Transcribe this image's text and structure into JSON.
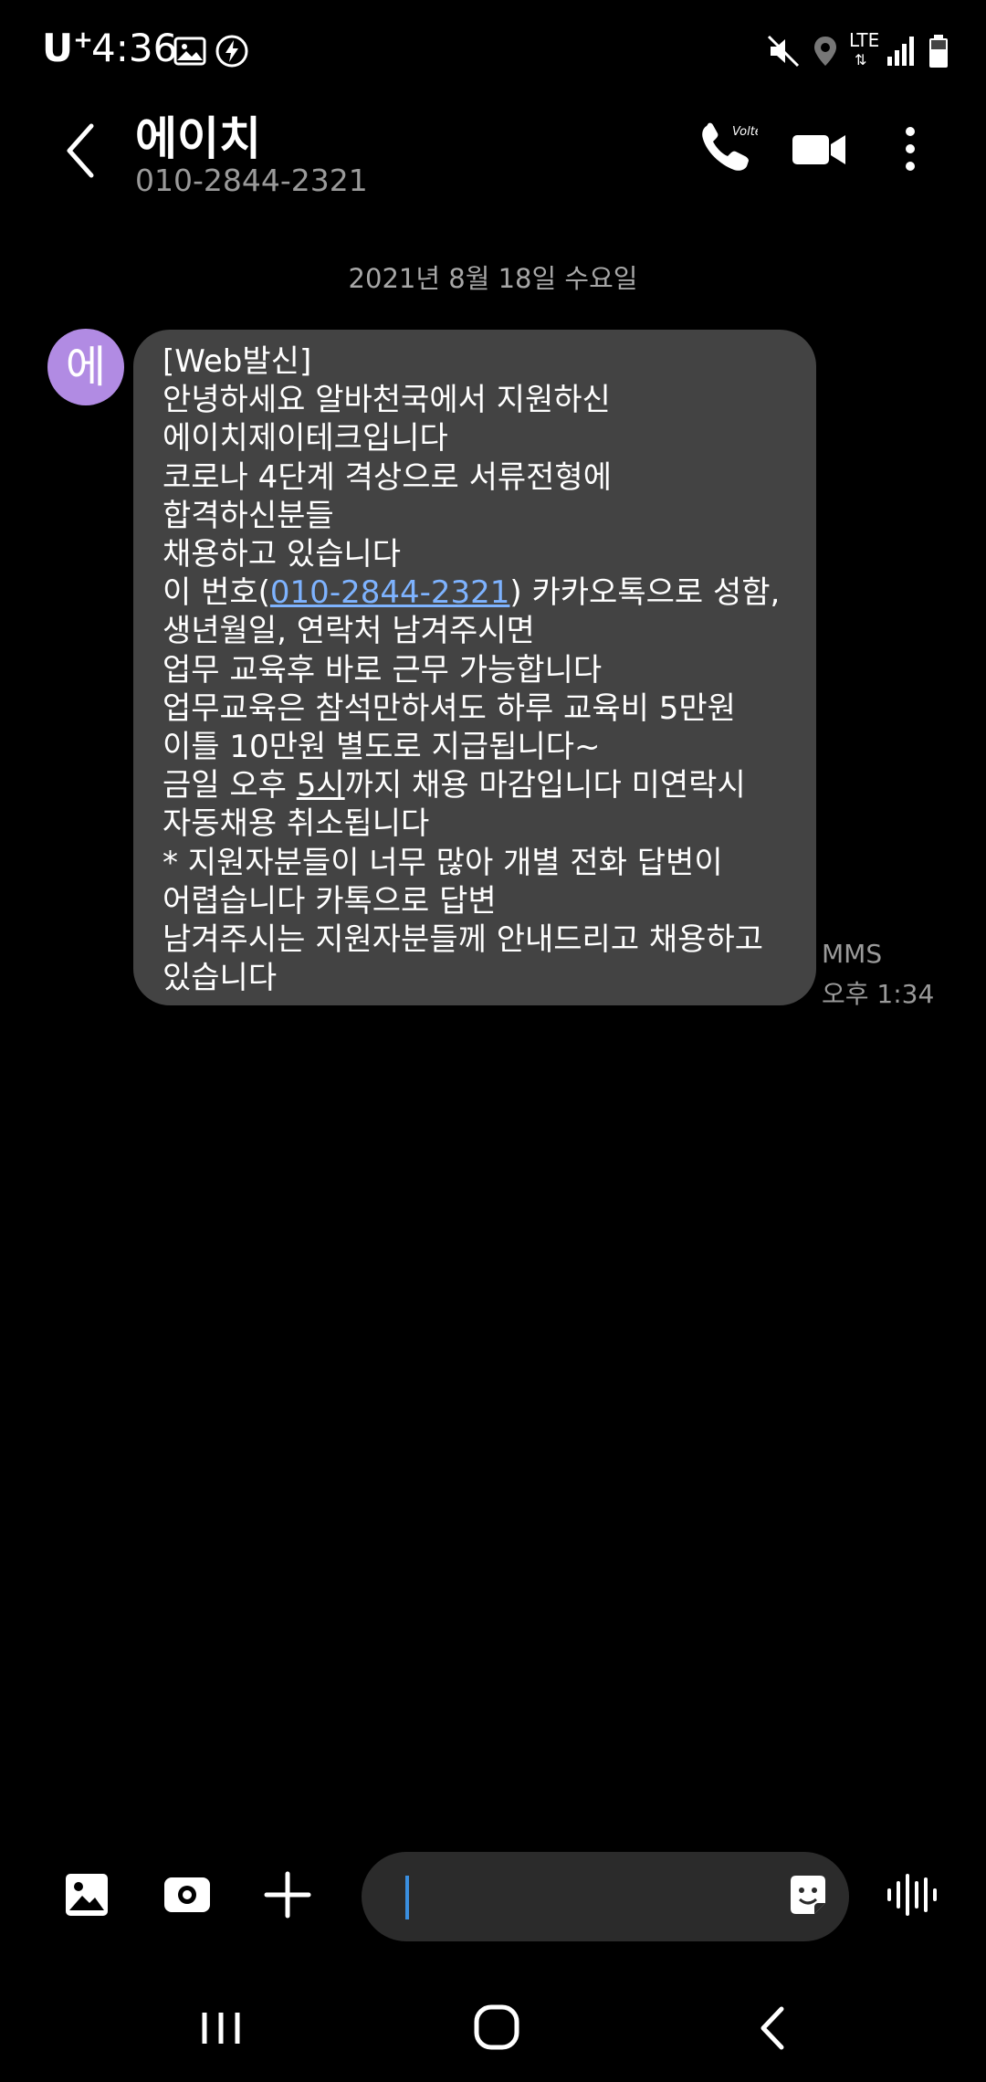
{
  "status_bar": {
    "carrier": "U",
    "carrier_sup": "+",
    "time": "4:36",
    "network": "LTE"
  },
  "header": {
    "contact_name": "에이치",
    "contact_number": "010-2844-2321",
    "call_badge": "Volte"
  },
  "conversation": {
    "date_separator": "2021년 8월 18일 수요일",
    "message": {
      "avatar_letter": "에",
      "text_before_link": "[Web발신]\n안녕하세요 알바천국에서 지원하신\n에이치제이테크입니다\n코로나 4단계 격상으로 서류전형에\n합격하신분들\n채용하고 있습니다\n이 번호(",
      "link_text": "010-2844-2321",
      "text_after_link": ") 카카오톡으로 성함,\n생년월일, 연락처 남겨주시면\n업무 교육후 바로 근무 가능합니다\n업무교육은 참석만하셔도 하루 교육비 5만원\n이틀 10만원 별도로 지급됩니다~\n금일 오후 ",
      "underlined_text": "5시",
      "text_end": "까지 채용 마감입니다 미연락시\n자동채용 취소됩니다\n* 지원자분들이 너무 많아 개별 전화 답변이\n어렵습니다 카톡으로 답변\n남겨주시는 지원자분들께 안내드리고 채용하고\n있습니다",
      "type": "MMS",
      "time": "오후 1:34"
    }
  },
  "composer": {
    "placeholder": ""
  },
  "colors": {
    "background": "#000000",
    "bubble": "#434343",
    "avatar": "#b18be3",
    "link": "#7eb3ff",
    "cursor": "#3a8fe0"
  }
}
